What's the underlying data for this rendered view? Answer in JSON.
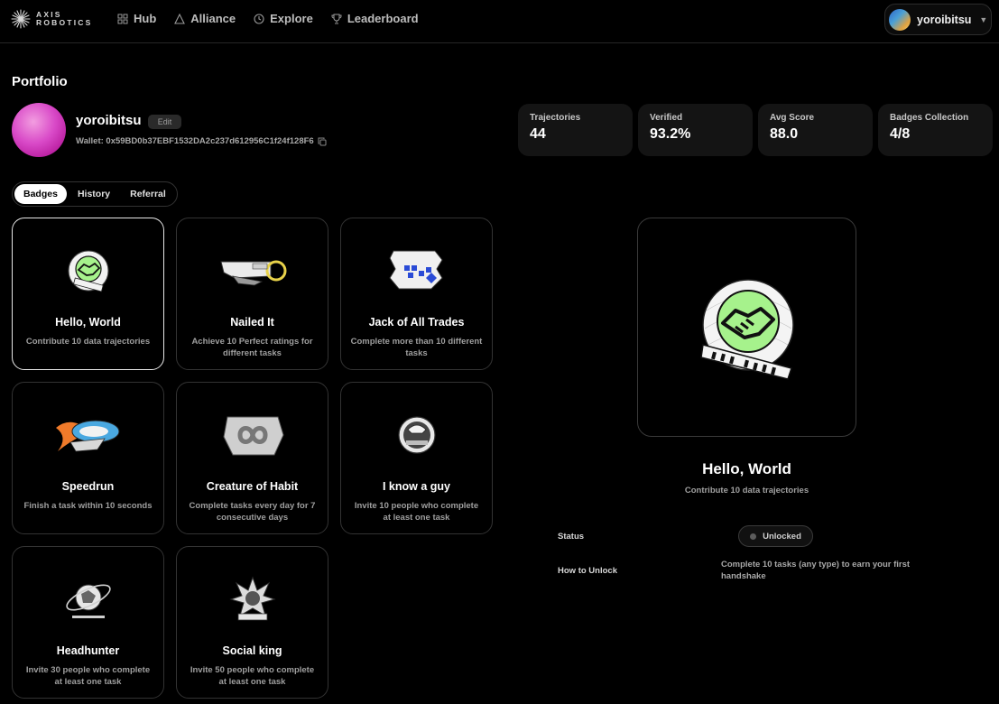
{
  "brand": {
    "line1": "AXIS",
    "line2": "ROBOTICS"
  },
  "nav": [
    {
      "label": "Hub",
      "icon": "grid-icon"
    },
    {
      "label": "Alliance",
      "icon": "triangle-icon"
    },
    {
      "label": "Explore",
      "icon": "clock-icon"
    },
    {
      "label": "Leaderboard",
      "icon": "trophy-icon"
    }
  ],
  "user": {
    "name": "yoroibitsu"
  },
  "page": {
    "title": "Portfolio"
  },
  "profile": {
    "name": "yoroibitsu",
    "edit_label": "Edit",
    "wallet": "Wallet: 0x59BD0b37EBF1532DA2c237d612956C1f24f128F6"
  },
  "stats": [
    {
      "label": "Trajectories",
      "value": "44"
    },
    {
      "label": "Verified",
      "value": "93.2%"
    },
    {
      "label": "Avg Score",
      "value": "88.0"
    },
    {
      "label": "Badges Collection",
      "value": "4/8"
    }
  ],
  "tabs": [
    {
      "label": "Badges",
      "active": true
    },
    {
      "label": "History",
      "active": false
    },
    {
      "label": "Referral",
      "active": false
    }
  ],
  "badges": [
    {
      "title": "Hello, World",
      "desc": "Contribute 10 data trajectories",
      "art_text": "Hello World",
      "icon": "handshake-icon"
    },
    {
      "title": "Nailed It",
      "desc": "Achieve 10 Perfect ratings for different tasks",
      "art_text": "Nailed It",
      "icon": "key-icon"
    },
    {
      "title": "Jack of All Trades",
      "desc": "Complete more than 10 different tasks",
      "art_text": "Jack of All Trades",
      "icon": "gear-icon"
    },
    {
      "title": "Speedrun",
      "desc": "Finish a task within 10 seconds",
      "art_text": "Speedrun",
      "icon": "flame-icon"
    },
    {
      "title": "Creature of Habit",
      "desc": "Complete tasks every day for 7 consecutive days",
      "art_text": "Creature of Habit",
      "icon": "infinity-icon"
    },
    {
      "title": "I know a guy",
      "desc": "Invite 10 people who complete at least one task",
      "art_text": "I know a guy",
      "icon": "hat-icon"
    },
    {
      "title": "Headhunter",
      "desc": "Invite 30 people who complete at least one task",
      "art_text": "Headhunter",
      "icon": "orbit-icon"
    },
    {
      "title": "Social king",
      "desc": "Invite 50 people who complete at least one task",
      "art_text": "Social king",
      "icon": "crown-icon"
    }
  ],
  "detail": {
    "title": "Hello, World",
    "desc": "Contribute 10 data trajectories",
    "status_label": "Status",
    "status_value": "Unlocked",
    "how_label": "How to Unlock",
    "how_value": "Complete 10 tasks (any type) to earn your first handshake"
  },
  "colors": {
    "accent_green": "#a6f28c",
    "selected_border": "#e8e8e8"
  }
}
